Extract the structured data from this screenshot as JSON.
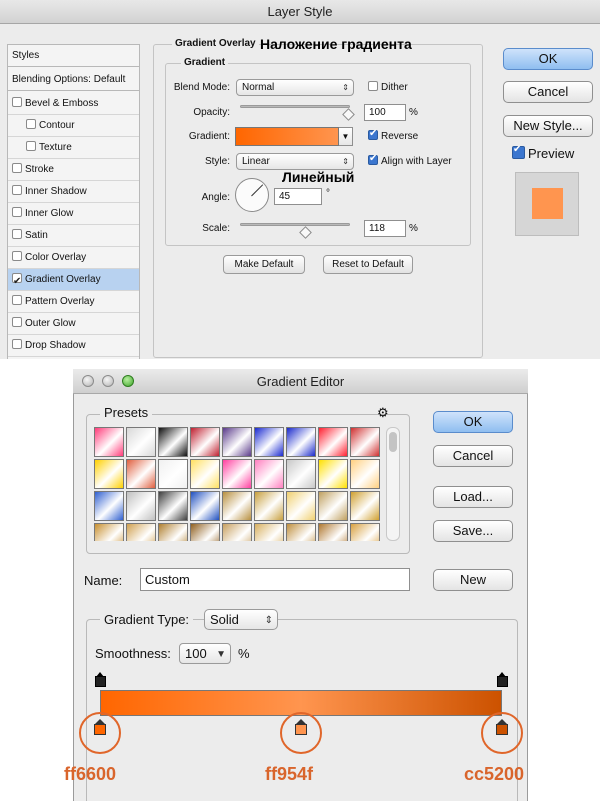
{
  "layer_style": {
    "title": "Layer Style",
    "sidebar": {
      "items": [
        {
          "label": "Styles",
          "checked": null
        },
        {
          "label": "Blending Options: Default",
          "checked": null
        },
        {
          "label": "Bevel & Emboss",
          "checked": false
        },
        {
          "label": "Contour",
          "checked": false
        },
        {
          "label": "Texture",
          "checked": false
        },
        {
          "label": "Stroke",
          "checked": false
        },
        {
          "label": "Inner Shadow",
          "checked": false
        },
        {
          "label": "Inner Glow",
          "checked": false
        },
        {
          "label": "Satin",
          "checked": false
        },
        {
          "label": "Color Overlay",
          "checked": false
        },
        {
          "label": "Gradient Overlay",
          "checked": true
        },
        {
          "label": "Pattern Overlay",
          "checked": false
        },
        {
          "label": "Outer Glow",
          "checked": false
        },
        {
          "label": "Drop Shadow",
          "checked": false
        }
      ]
    },
    "panel": {
      "group_title": "Gradient Overlay",
      "group_title_ru": "Наложение градиента",
      "subgroup_title": "Gradient",
      "blend_mode_label": "Blend Mode:",
      "blend_mode_value": "Normal",
      "dither_label": "Dither",
      "dither_checked": false,
      "opacity_label": "Opacity:",
      "opacity_value": "100",
      "opacity_unit": "%",
      "opacity_fraction": 1.0,
      "gradient_label": "Gradient:",
      "reverse_label": "Reverse",
      "reverse_checked": true,
      "style_label": "Style:",
      "style_value": "Linear",
      "style_value_ru": "Линейный",
      "align_label": "Align with Layer",
      "align_checked": true,
      "angle_label": "Angle:",
      "angle_value": "45",
      "angle_unit": "°",
      "scale_label": "Scale:",
      "scale_value": "118",
      "scale_unit": "%",
      "scale_fraction": 0.59,
      "make_default_label": "Make Default",
      "reset_default_label": "Reset to Default"
    },
    "buttons": {
      "ok": "OK",
      "cancel": "Cancel",
      "new_style": "New Style..."
    },
    "preview": {
      "label": "Preview",
      "checked": true,
      "swatch_color": "#ff954f"
    }
  },
  "gradient_editor": {
    "title": "Gradient Editor",
    "presets_label": "Presets",
    "presets": [
      [
        "#ff3c7a",
        "#d8d8d8",
        "#101010",
        "#c02030",
        "#5a3a8a",
        "#1a2ad0",
        "#1a2acc",
        "#ff2030",
        "#d03030"
      ],
      [
        "#ffd000",
        "#e06040",
        "#f0f0f0",
        "#ffe060",
        "#ff40a0",
        "#ff80c0",
        "#c8c8c8",
        "#ffe000",
        "#ffd080"
      ],
      [
        "#3060d0",
        "#c0c0c0",
        "#404040",
        "#2050c0",
        "#b89040",
        "#c8a040",
        "#f0d070",
        "#c0a060",
        "#d0a030"
      ],
      [
        "#c89030",
        "#d0a050",
        "#b08030",
        "#906020",
        "#c8a060",
        "#d8b060",
        "#c09040",
        "#b07830",
        "#d8a040"
      ]
    ],
    "name_label": "Name:",
    "name_value": "Custom",
    "buttons": {
      "ok": "OK",
      "cancel": "Cancel",
      "load": "Load...",
      "save": "Save...",
      "new": "New"
    },
    "gradient_type_label": "Gradient Type:",
    "gradient_type_value": "Solid",
    "smoothness_label": "Smoothness:",
    "smoothness_value": "100",
    "smoothness_unit": "%",
    "color_stops": [
      {
        "position": 0.0,
        "color": "#ff6600",
        "label": "ff6600"
      },
      {
        "position": 0.5,
        "color": "#ff954f",
        "label": "ff954f"
      },
      {
        "position": 1.0,
        "color": "#cc5200",
        "label": "cc5200"
      }
    ],
    "opacity_stops": [
      0.0,
      1.0
    ]
  },
  "icons": {
    "gear": "⚙",
    "up_down": "⇕",
    "down": "▼",
    "chevron_down": "▾"
  }
}
